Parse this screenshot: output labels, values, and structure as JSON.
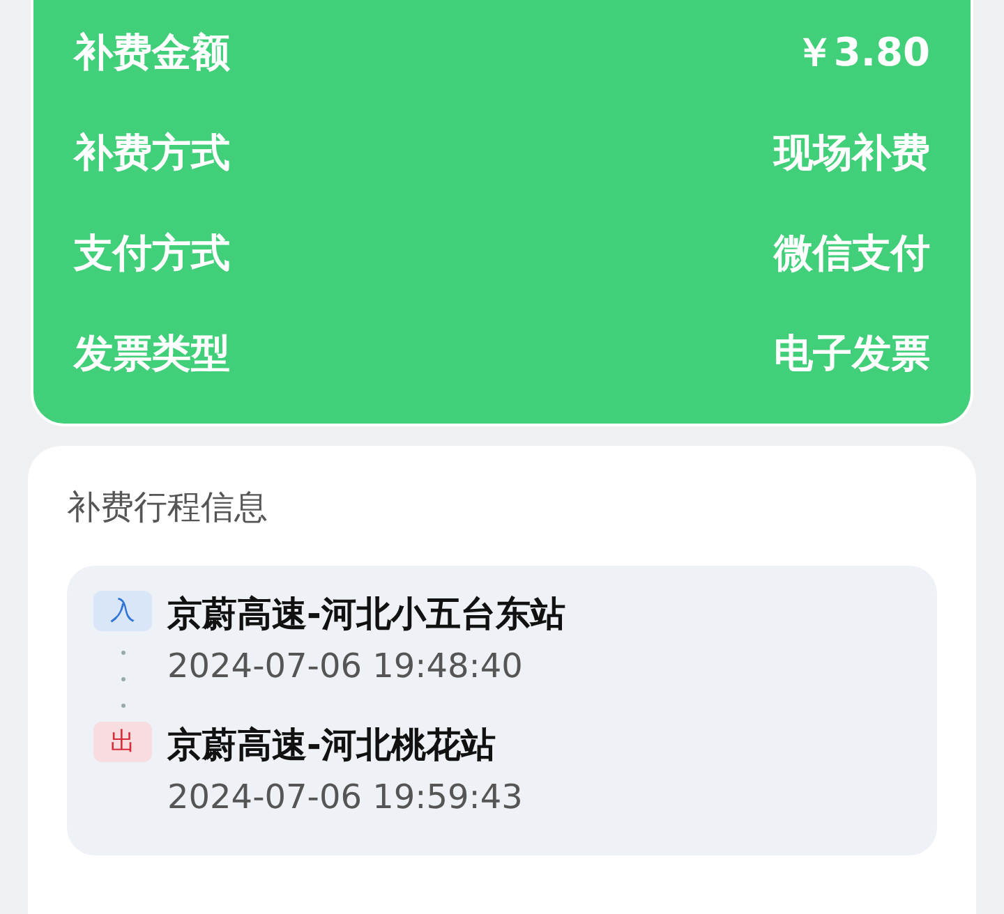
{
  "summary": {
    "rows": [
      {
        "label": "补费金额",
        "value": "￥3.80"
      },
      {
        "label": "补费方式",
        "value": "现场补费"
      },
      {
        "label": "支付方式",
        "value": "微信支付"
      },
      {
        "label": "发票类型",
        "value": "电子发票"
      }
    ]
  },
  "trip": {
    "title": "补费行程信息",
    "stops": [
      {
        "kind": "entry",
        "badge": "入",
        "station": "京蔚高速-河北小五台东站",
        "time": "2024-07-06 19:48:40"
      },
      {
        "kind": "exit",
        "badge": "出",
        "station": "京蔚高速-河北桃花站",
        "time": "2024-07-06 19:59:43"
      }
    ]
  }
}
